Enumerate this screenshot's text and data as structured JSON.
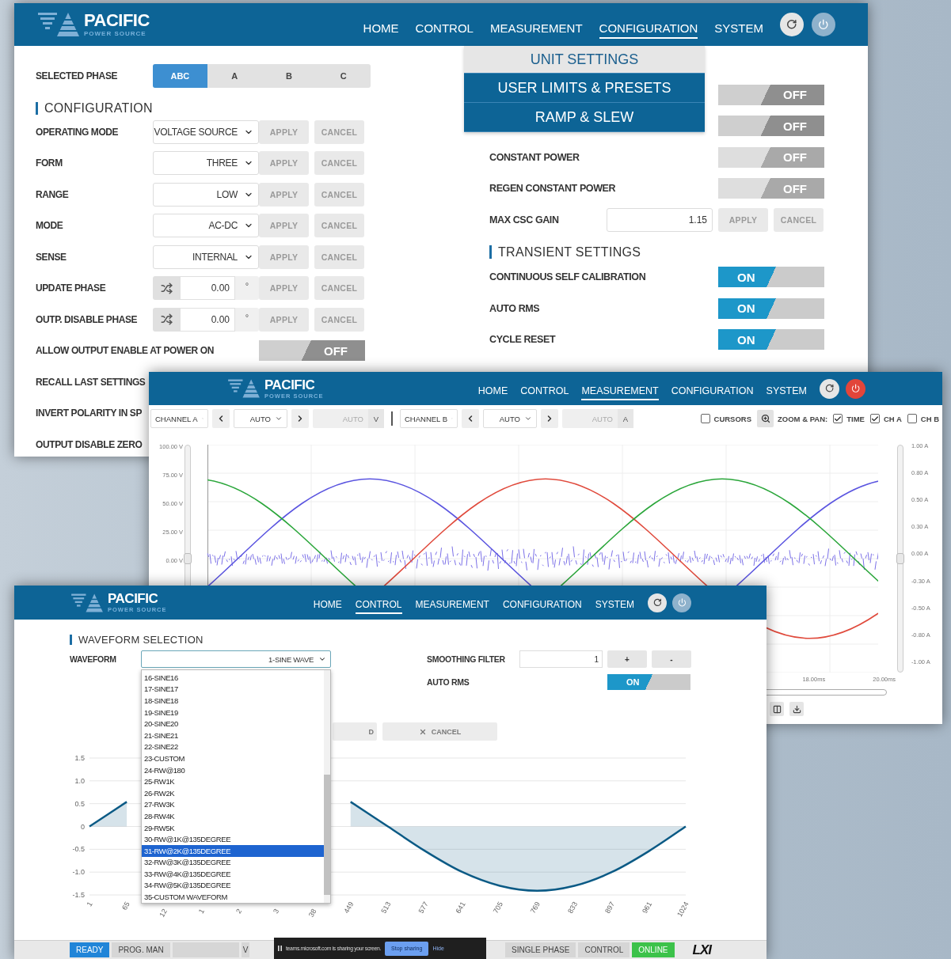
{
  "configuration_window": {
    "header": {
      "logo": {
        "name": "PACIFIC",
        "tagline": "POWER SOURCE"
      },
      "nav": [
        {
          "label": "HOME",
          "selected": false
        },
        {
          "label": "CONTROL",
          "selected": false
        },
        {
          "label": "MEASUREMENT",
          "selected": false
        },
        {
          "label": "CONFIGURATION",
          "selected": true
        },
        {
          "label": "SYSTEM",
          "selected": false
        }
      ],
      "power_alert": false
    },
    "selected_phase": {
      "label": "SELECTED PHASE",
      "options": [
        {
          "label": "ABC",
          "selected": true
        },
        {
          "label": "A",
          "selected": false
        },
        {
          "label": "B",
          "selected": false
        },
        {
          "label": "C",
          "selected": false
        }
      ]
    },
    "section_title": "CONFIGURATION",
    "rows": [
      {
        "kind": "select",
        "label": "OPERATING MODE",
        "value": "VOLTAGE SOURCE",
        "apply": "APPLY",
        "cancel": "CANCEL"
      },
      {
        "kind": "select",
        "label": "FORM",
        "value": "THREE",
        "apply": "APPLY",
        "cancel": "CANCEL"
      },
      {
        "kind": "select",
        "label": "RANGE",
        "value": "LOW",
        "apply": "APPLY",
        "cancel": "CANCEL"
      },
      {
        "kind": "select",
        "label": "MODE",
        "value": "AC-DC",
        "apply": "APPLY",
        "cancel": "CANCEL"
      },
      {
        "kind": "select",
        "label": "SENSE",
        "value": "INTERNAL",
        "apply": "APPLY",
        "cancel": "CANCEL"
      },
      {
        "kind": "phase",
        "label": "UPDATE PHASE",
        "value": "0.00",
        "unit": "°",
        "apply": "APPLY",
        "cancel": "CANCEL"
      },
      {
        "kind": "phase",
        "label": "OUTP. DISABLE PHASE",
        "value": "0.00",
        "unit": "°",
        "apply": "APPLY",
        "cancel": "CANCEL"
      },
      {
        "kind": "toggle",
        "label": "ALLOW OUTPUT ENABLE AT POWER ON",
        "toggle": {
          "on": false,
          "label": "OFF",
          "disabled": false
        }
      },
      {
        "kind": "label",
        "label": "RECALL LAST SETTINGS"
      },
      {
        "kind": "label",
        "label": "INVERT POLARITY IN SP"
      },
      {
        "kind": "label",
        "label": "OUTPUT DISABLE ZERO"
      }
    ],
    "menu": [
      {
        "label": "UNIT SETTINGS",
        "selected": true
      },
      {
        "label": "USER LIMITS & PRESETS",
        "selected": false
      },
      {
        "label": "RAMP & SLEW",
        "selected": false
      }
    ],
    "settings": [
      {
        "kind": "toggle",
        "toggle": {
          "on": false,
          "label": "OFF",
          "disabled": false
        }
      },
      {
        "kind": "toggle",
        "toggle": {
          "on": false,
          "label": "OFF",
          "disabled": false
        }
      },
      {
        "kind": "toggle",
        "label": "CONSTANT POWER",
        "toggle": {
          "on": false,
          "label": "OFF",
          "disabled": true
        }
      },
      {
        "kind": "toggle",
        "label": "REGEN CONSTANT POWER",
        "toggle": {
          "on": false,
          "label": "OFF",
          "disabled": true
        }
      },
      {
        "kind": "input",
        "label": "MAX CSC GAIN",
        "value": "1.15",
        "apply": "APPLY",
        "cancel": "CANCEL"
      },
      {
        "kind": "section",
        "label": "TRANSIENT SETTINGS"
      },
      {
        "kind": "toggle",
        "label": "CONTINUOUS SELF CALIBRATION",
        "toggle": {
          "on": true,
          "label": "ON",
          "disabled": false
        }
      },
      {
        "kind": "toggle",
        "label": "AUTO RMS",
        "toggle": {
          "on": true,
          "label": "ON",
          "disabled": false
        }
      },
      {
        "kind": "toggle",
        "label": "CYCLE RESET",
        "toggle": {
          "on": true,
          "label": "ON",
          "disabled": false
        }
      }
    ]
  },
  "measurement_window": {
    "header": {
      "logo": {
        "name": "PACIFIC",
        "tagline": "POWER SOURCE"
      },
      "nav": [
        {
          "label": "HOME",
          "selected": false
        },
        {
          "label": "CONTROL",
          "selected": false
        },
        {
          "label": "MEASUREMENT",
          "selected": true
        },
        {
          "label": "CONFIGURATION",
          "selected": false
        },
        {
          "label": "SYSTEM",
          "selected": false
        }
      ],
      "power_alert": true
    },
    "channels": [
      {
        "select": "CHANNEL A",
        "scale": "AUTO",
        "readout": "AUTO",
        "unit": "V"
      },
      {
        "select": "CHANNEL B",
        "scale": "AUTO",
        "readout": "AUTO",
        "unit": "A"
      }
    ],
    "options": [
      {
        "kind": "checkbox",
        "label": "CURSORS",
        "checked": false
      },
      {
        "kind": "zoom",
        "label": "ZOOM & PAN:"
      },
      {
        "kind": "checkbox",
        "label": "TIME",
        "checked": true
      },
      {
        "kind": "checkbox",
        "label": "CH A",
        "checked": true
      },
      {
        "kind": "checkbox",
        "label": "CH B",
        "checked": false
      }
    ],
    "left_axis": [
      "100.00 V",
      "75.00 V",
      "50.00 V",
      "25.00 V",
      "0.00 V"
    ],
    "left_slider": {
      "level": 0.5
    },
    "right_slider": {
      "level": 0.5
    },
    "right_axis": [
      "1.00 A",
      "0.80 A",
      "0.50 A",
      "0.30 A",
      "0.00 A",
      "-0.30 A",
      "-0.50 A",
      "-0.80 A",
      "-1.00 A"
    ],
    "time_axis": [
      "18.00ms",
      "20.00ms"
    ]
  },
  "control_window": {
    "header": {
      "logo": {
        "name": "PACIFIC",
        "tagline": "POWER SOURCE"
      },
      "nav": [
        {
          "label": "HOME",
          "selected": false
        },
        {
          "label": "CONTROL",
          "selected": true
        },
        {
          "label": "MEASUREMENT",
          "selected": false
        },
        {
          "label": "CONFIGURATION",
          "selected": false
        },
        {
          "label": "SYSTEM",
          "selected": false
        }
      ],
      "power_alert": false
    },
    "section_title": "WAVEFORM SELECTION",
    "waveform": {
      "label": "WAVEFORM",
      "value": "1-SINE WAVE",
      "options": [
        {
          "label": "16-SINE16",
          "selected": false
        },
        {
          "label": "17-SINE17",
          "selected": false
        },
        {
          "label": "18-SINE18",
          "selected": false
        },
        {
          "label": "19-SINE19",
          "selected": false
        },
        {
          "label": "20-SINE20",
          "selected": false
        },
        {
          "label": "21-SINE21",
          "selected": false
        },
        {
          "label": "22-SINE22",
          "selected": false
        },
        {
          "label": "23-CUSTOM",
          "selected": false
        },
        {
          "label": "24-RW@180",
          "selected": false
        },
        {
          "label": "25-RW1K",
          "selected": false
        },
        {
          "label": "26-RW2K",
          "selected": false
        },
        {
          "label": "27-RW3K",
          "selected": false
        },
        {
          "label": "28-RW4K",
          "selected": false
        },
        {
          "label": "29-RW5K",
          "selected": false
        },
        {
          "label": "30-RW@1K@135DEGREE",
          "selected": false
        },
        {
          "label": "31-RW@2K@135DEGREE",
          "selected": true
        },
        {
          "label": "32-RW@3K@135DEGREE",
          "selected": false
        },
        {
          "label": "33-RW@4K@135DEGREE",
          "selected": false
        },
        {
          "label": "34-RW@5K@135DEGREE",
          "selected": false
        },
        {
          "label": "35-CUSTOM WAVEFORM",
          "selected": false
        }
      ]
    },
    "smoothing_filter": {
      "label": "SMOOTHING FILTER",
      "value": "1",
      "increment": "+",
      "decrement": "-"
    },
    "auto_rms": {
      "label": "AUTO RMS",
      "toggle": {
        "on": true,
        "label": "ON"
      }
    },
    "buttons": [
      {
        "kind": "plain",
        "label": "D"
      },
      {
        "kind": "cancel",
        "label": "CANCEL"
      }
    ],
    "chart_data": {
      "type": "area",
      "grid": true,
      "xlim": [
        1,
        1024
      ],
      "ylim": [
        -1.5,
        1.5
      ],
      "x": [
        1,
        65,
        129,
        193,
        257,
        321,
        385,
        449,
        513,
        577,
        641,
        705,
        769,
        833,
        897,
        961,
        1024
      ],
      "series": [
        {
          "color": "#0b5a85",
          "values": [
            0,
            0.54,
            null,
            null,
            null,
            null,
            null,
            0.54,
            0,
            -0.54,
            -1.0,
            -1.3,
            -1.41,
            -1.3,
            -1.0,
            -0.54,
            0
          ]
        }
      ],
      "yticks": [
        {
          "value": 1.5,
          "label": "1.5"
        },
        {
          "value": 1,
          "label": "1.0"
        },
        {
          "value": 0.5,
          "label": "0.5"
        },
        {
          "value": 0,
          "label": "0"
        },
        {
          "value": -0.5,
          "label": "-0.5"
        },
        {
          "value": -1,
          "label": "-1.0"
        },
        {
          "value": -1.5,
          "label": "-1.5"
        }
      ],
      "xticks": [
        1,
        65,
        449,
        513,
        577,
        641,
        705,
        769,
        833,
        897,
        961,
        1024
      ]
    },
    "tick_fragments": [
      "12",
      "1",
      "2",
      "3",
      "38"
    ],
    "status_bar": {
      "left": [
        {
          "kind": "active",
          "label": "READY"
        },
        {
          "kind": "plain",
          "label": "PROG. MAN"
        },
        {
          "kind": "blank"
        },
        {
          "kind": "cut",
          "label": "V"
        }
      ],
      "right": [
        {
          "kind": "plain",
          "label": "SINGLE PHASE"
        },
        {
          "kind": "plain",
          "label": "CONTROL"
        },
        {
          "kind": "online",
          "label": "ONLINE"
        }
      ],
      "logo": "LXI"
    }
  },
  "screen_share_bar": {
    "message": "teams.microsoft.com is sharing your screen.",
    "stop": "Stop sharing",
    "hide": "Hide"
  }
}
